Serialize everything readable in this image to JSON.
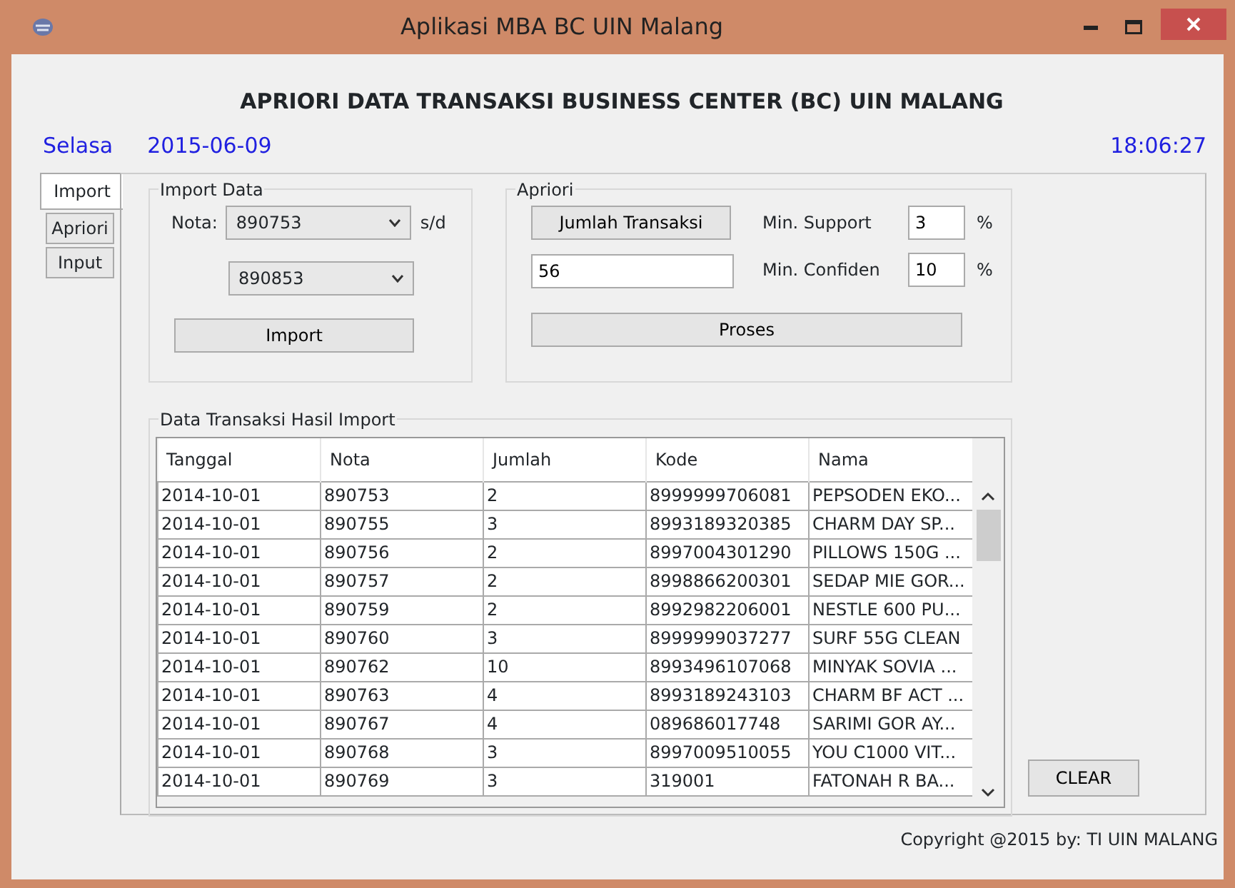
{
  "window": {
    "title": "Aplikasi MBA BC UIN Malang"
  },
  "heading": "APRIORI DATA TRANSAKSI BUSINESS CENTER (BC) UIN MALANG",
  "day": "Selasa",
  "date": "2015-06-09",
  "time": "18:06:27",
  "tabs": [
    {
      "label": "Import",
      "selected": true
    },
    {
      "label": "Apriori",
      "selected": false
    },
    {
      "label": "Input",
      "selected": false
    }
  ],
  "import_data": {
    "title": "Import Data",
    "nota_label": "Nota:",
    "from": "890753",
    "to_label": "s/d",
    "to": "890853",
    "button": "Import"
  },
  "apriori": {
    "title": "Apriori",
    "count_button": "Jumlah Transaksi",
    "count": "56",
    "support_label": "Min. Support",
    "support": "3",
    "support_unit": "%",
    "confidence_label": "Min. Confiden",
    "confidence": "10",
    "confidence_unit": "%",
    "button": "Proses"
  },
  "table": {
    "title": "Data Transaksi Hasil Import",
    "columns": [
      "Tanggal",
      "Nota",
      "Jumlah",
      "Kode",
      "Nama"
    ],
    "rows": [
      [
        "2014-10-01",
        "890753",
        "2",
        "8999999706081",
        "PEPSODEN EKO..."
      ],
      [
        "2014-10-01",
        "890755",
        "3",
        "8993189320385",
        "CHARM DAY SP..."
      ],
      [
        "2014-10-01",
        "890756",
        "2",
        "8997004301290",
        "PILLOWS 150G ..."
      ],
      [
        "2014-10-01",
        "890757",
        "2",
        "8998866200301",
        "SEDAP MIE GOR..."
      ],
      [
        "2014-10-01",
        "890759",
        "2",
        "8992982206001",
        "NESTLE 600 PU..."
      ],
      [
        "2014-10-01",
        "890760",
        "3",
        "8999999037277",
        "SURF 55G CLEAN"
      ],
      [
        "2014-10-01",
        "890762",
        "10",
        "8993496107068",
        "MINYAK SOVIA ..."
      ],
      [
        "2014-10-01",
        "890763",
        "4",
        "8993189243103",
        "CHARM BF ACT ..."
      ],
      [
        "2014-10-01",
        "890767",
        "4",
        "089686017748",
        "SARIMI GOR AY..."
      ],
      [
        "2014-10-01",
        "890768",
        "3",
        "8997009510055",
        "YOU C1000 VIT..."
      ],
      [
        "2014-10-01",
        "890769",
        "3",
        "319001",
        "FATONAH R BA..."
      ]
    ]
  },
  "clear_button": "CLEAR",
  "copyright": "Copyright @2015 by: TI UIN MALANG"
}
